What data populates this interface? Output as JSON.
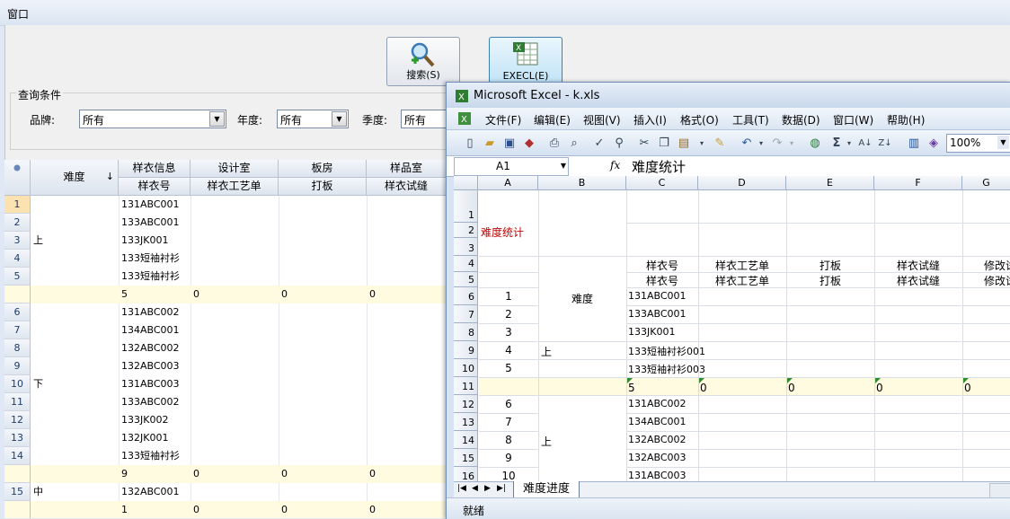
{
  "app": {
    "title": "窗口"
  },
  "toolbar": {
    "search_label": "搜索(S)",
    "execl_label": "EXECL(E)"
  },
  "query": {
    "legend": "查询条件",
    "brand_label": "品牌:",
    "brand_value": "所有",
    "year_label": "年度:",
    "year_value": "所有",
    "season_label": "季度:",
    "season_value": "所有"
  },
  "grid": {
    "col_nandu": "难度",
    "headers_top": [
      "样衣信息",
      "设计室",
      "板房",
      "样品室"
    ],
    "headers_bottom": [
      "样衣号",
      "样衣工艺单",
      "打板",
      "样衣试缝"
    ],
    "rows": [
      {
        "num": "1",
        "code": "131ABC001"
      },
      {
        "num": "2",
        "code": "133ABC001"
      },
      {
        "num": "3",
        "code": "133JK001"
      },
      {
        "num": "4",
        "code": "133短袖衬衫"
      },
      {
        "num": "5",
        "code": "133短袖衬衫"
      },
      {
        "num": "6",
        "code": "131ABC002"
      },
      {
        "num": "7",
        "code": "134ABC001"
      },
      {
        "num": "8",
        "code": "132ABC002"
      },
      {
        "num": "9",
        "code": "132ABC003"
      },
      {
        "num": "10",
        "code": "131ABC003"
      },
      {
        "num": "11",
        "code": "133ABC002"
      },
      {
        "num": "12",
        "code": "133JK002"
      },
      {
        "num": "13",
        "code": "132JK001"
      },
      {
        "num": "14",
        "code": "133短袖衬衫"
      },
      {
        "num": "15",
        "code": "132ABC001"
      }
    ],
    "groups": [
      "上",
      "下",
      "中"
    ],
    "sums": [
      {
        "count": "5",
        "v1": "0",
        "v2": "0",
        "v3": "0"
      },
      {
        "count": "9",
        "v1": "0",
        "v2": "0",
        "v3": "0"
      },
      {
        "count": "1",
        "v1": "0",
        "v2": "0",
        "v3": "0"
      }
    ]
  },
  "excel": {
    "title": "Microsoft Excel - k.xls",
    "menu": [
      "文件(F)",
      "编辑(E)",
      "视图(V)",
      "插入(I)",
      "格式(O)",
      "工具(T)",
      "数据(D)",
      "窗口(W)",
      "帮助(H)"
    ],
    "zoom": "100%",
    "namebox": "A1",
    "fx": "fx",
    "formula": "难度统计",
    "columns": [
      "A",
      "B",
      "C",
      "D",
      "E",
      "F",
      "G"
    ],
    "row_numbers": [
      "1",
      "2",
      "3",
      "4",
      "5",
      "6",
      "7",
      "8",
      "9",
      "10",
      "11",
      "12",
      "13",
      "14",
      "15",
      "16"
    ],
    "title_cell": "难度统计",
    "header_row": [
      "样衣号",
      "样衣工艺单",
      "打板",
      "样衣试缝",
      "修改试"
    ],
    "b_labels": [
      "难度",
      "上",
      "上"
    ],
    "a_values": [
      "1",
      "2",
      "3",
      "4",
      "5",
      "6",
      "7",
      "8",
      "9",
      "10"
    ],
    "c_values": [
      "131ABC001",
      "133ABC001",
      "133JK001",
      "133短袖衬衫001",
      "133短袖衬衫003",
      "131ABC002",
      "134ABC001",
      "132ABC002",
      "132ABC003",
      "131ABC003"
    ],
    "sum_values": [
      "5",
      "0",
      "0",
      "0",
      "0"
    ],
    "sheet_tab": "难度进度",
    "status": "就绪"
  }
}
